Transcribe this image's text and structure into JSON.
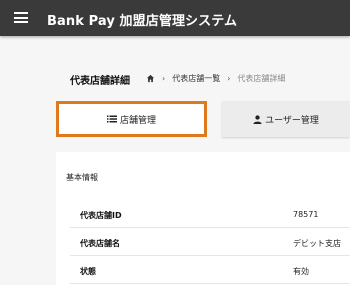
{
  "header": {
    "title": "Bank Pay 加盟店管理システム",
    "menu_icon": "hamburger-menu-icon",
    "background": "#3a3a3a"
  },
  "page": {
    "title": "代表店舗詳細"
  },
  "breadcrumb": {
    "home_icon": "home-icon",
    "items": [
      "代表店舗一覧",
      "代表店舗詳細"
    ]
  },
  "tabs": [
    {
      "label": "店舗管理",
      "icon": "list-icon",
      "selected": true
    },
    {
      "label": "ユーザー管理",
      "icon": "person-icon",
      "selected": false
    }
  ],
  "basic_info": {
    "section_title": "基本情報",
    "rows": [
      {
        "label": "代表店舗ID",
        "value": "78571"
      },
      {
        "label": "代表店舗名",
        "value": "デビット支店"
      },
      {
        "label": "状態",
        "value": "有効"
      }
    ]
  },
  "colors": {
    "accent_orange": "#e0791e",
    "app_bar": "#3a3a3a"
  }
}
